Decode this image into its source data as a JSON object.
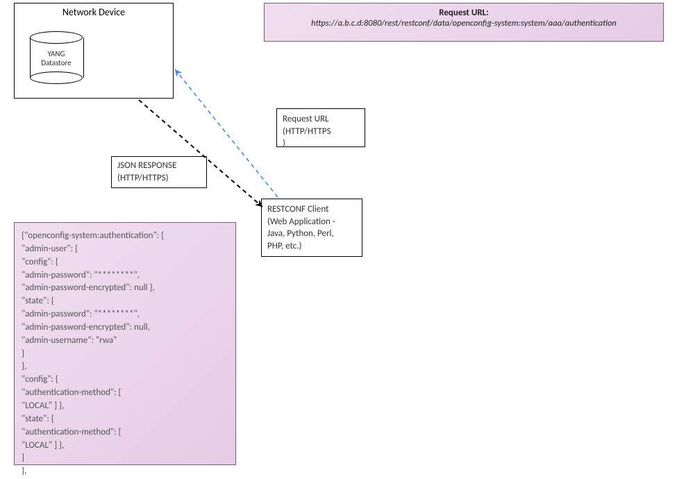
{
  "device": {
    "title": "Network Device",
    "datastore_label_l1": "YANG",
    "datastore_label_l2": "Datastore"
  },
  "request_url_panel": {
    "title": "Request URL:",
    "url": "https://a.b.c.d:8080/rest/restconf/data/openconfig-system:system/aaa/authentication"
  },
  "request_url_label": {
    "line1": "Request URL",
    "line2": "(HTTP/HTTPS",
    "line3": ")"
  },
  "json_response_label": {
    "line1": "JSON RESPONSE",
    "line2": "(HTTP/HTTPS)"
  },
  "client": {
    "line1": "RESTCONF Client",
    "line2": "(Web Application -",
    "line3": "Java, Python, Perl,",
    "line4": "PHP, etc.)"
  },
  "json_payload": "{\"openconfig-system:authentication\": {\n\"admin-user\": {\n\"config\": {\n\"admin-password\": \"********\",\n\"admin-password-encrypted\": null },\n\"state\": {\n\"admin-password\": \"********\",\n\"admin-password-encrypted\": null,\n\"admin-username\": \"rwa\"\n}\n},\n\"config\": {\n\"authentication-method\": [\n\"LOCAL\" ] },\n\"state\": {\n\"authentication-method\": [\n\"LOCAL\" ] },\n]\n},"
}
